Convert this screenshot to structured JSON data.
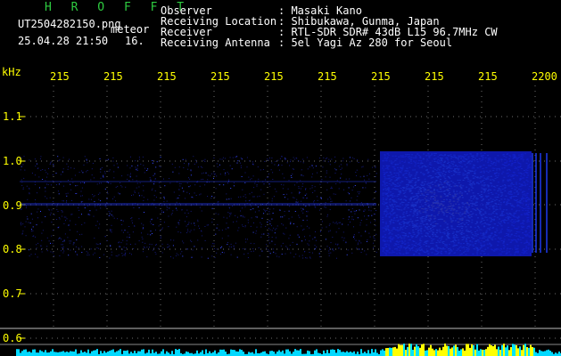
{
  "header": {
    "app_title": "H R O F F T",
    "filename": "UT2504282150.png",
    "tag": "meteor",
    "datetime": "25.04.28 21:50",
    "count": "16.",
    "info": [
      {
        "label": "Observer",
        "value": ": Masaki Kano"
      },
      {
        "label": "Receiving Location",
        "value": ": Shibukawa, Gunma, Japan"
      },
      {
        "label": "Receiver",
        "value": ": RTL-SDR SDR# 43dB L15 96.7MHz CW"
      },
      {
        "label": "Receiving Antenna",
        "value": ": 5el Yagi Az 280 for Seoul"
      }
    ]
  },
  "xaxis": {
    "ticks": [
      "215",
      "215",
      "215",
      "215",
      "215",
      "215",
      "215",
      "215",
      "215",
      "2200"
    ]
  },
  "yaxis": {
    "unit": "kHz",
    "ticks": [
      "1.1",
      "1.0",
      "0.9",
      "0.8",
      "0.7",
      "0.6"
    ]
  },
  "colors": {
    "background": "#000000",
    "grid": "#6e6e6e",
    "tick_text": "#ffff00",
    "signal_low": "#1a24ff",
    "signal_high": "#ffff00",
    "app_title": "#2ecc40"
  }
}
